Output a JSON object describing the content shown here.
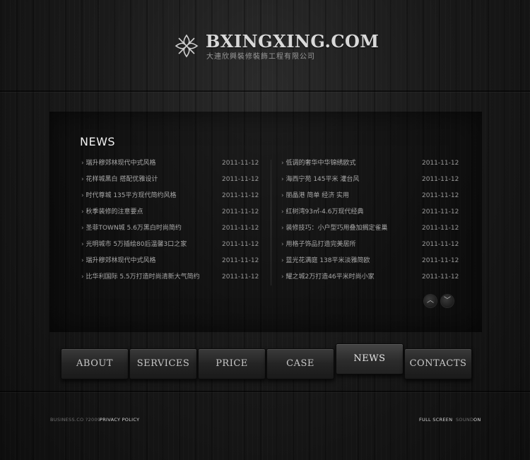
{
  "header": {
    "logo_title": "BXINGXING.COM",
    "logo_subtitle": "大連欣興裝修裝飾工程有限公司",
    "logo_icon": "flower-emblem-icon"
  },
  "news": {
    "heading": "NEWS",
    "left": [
      {
        "title": "瑞升穆郊林现代中式风格",
        "date": "2011-11-12"
      },
      {
        "title": "花样城黑白 搭配优雅设计",
        "date": "2011-11-12"
      },
      {
        "title": "时代尊城 135平方现代简约风格",
        "date": "2011-11-12"
      },
      {
        "title": "秋季装修的注意要点",
        "date": "2011-11-12"
      },
      {
        "title": "圣菲TOWN城 5.6万黑白时尚简约",
        "date": "2011-11-12"
      },
      {
        "title": "光明城市 5万插绘80后温馨3口之家",
        "date": "2011-11-12"
      },
      {
        "title": "瑞升穆郊林现代中式风格",
        "date": "2011-11-12"
      },
      {
        "title": "比华利国际 5.5万打造时尚清新大气简约",
        "date": "2011-11-12"
      }
    ],
    "right": [
      {
        "title": "低调的奢华中华锦绣欧式",
        "date": "2011-11-12"
      },
      {
        "title": "海西宁苑 145平米 灌台风",
        "date": "2011-11-12"
      },
      {
        "title": "丽晶港 简单 经济 实用",
        "date": "2011-11-12"
      },
      {
        "title": "红树湾93㎡-4.6万现代经典",
        "date": "2011-11-12"
      },
      {
        "title": "装修技巧：小户型巧用叠加搁定雀巢",
        "date": "2011-11-12"
      },
      {
        "title": "用格子饰品打造完美居所",
        "date": "2011-11-12"
      },
      {
        "title": "蓝光花满庭 138平米淡雅简欧",
        "date": "2011-11-12"
      },
      {
        "title": "耀之城2万打造46平米时尚小家",
        "date": "2011-11-12"
      }
    ],
    "scroll_up_icon": "chevron-up-icon",
    "scroll_down_icon": "chevron-down-icon"
  },
  "nav": {
    "items": [
      {
        "label": "ABOUT"
      },
      {
        "label": "SERVICES"
      },
      {
        "label": "PRICE"
      },
      {
        "label": "CASE"
      },
      {
        "label": "NEWS"
      },
      {
        "label": "CONTACTS"
      }
    ],
    "active_index": 4
  },
  "footer": {
    "copyright": "BUSINESS.CO ?2009",
    "privacy_link": "PRIVACY POLICY",
    "full_screen": "FULL SCREEN",
    "sound_label": "SOUND:",
    "sound_value": "ON"
  },
  "colors": {
    "background": "#141414",
    "text_primary": "#f0f0f0",
    "text_secondary": "#a9a9a9"
  }
}
